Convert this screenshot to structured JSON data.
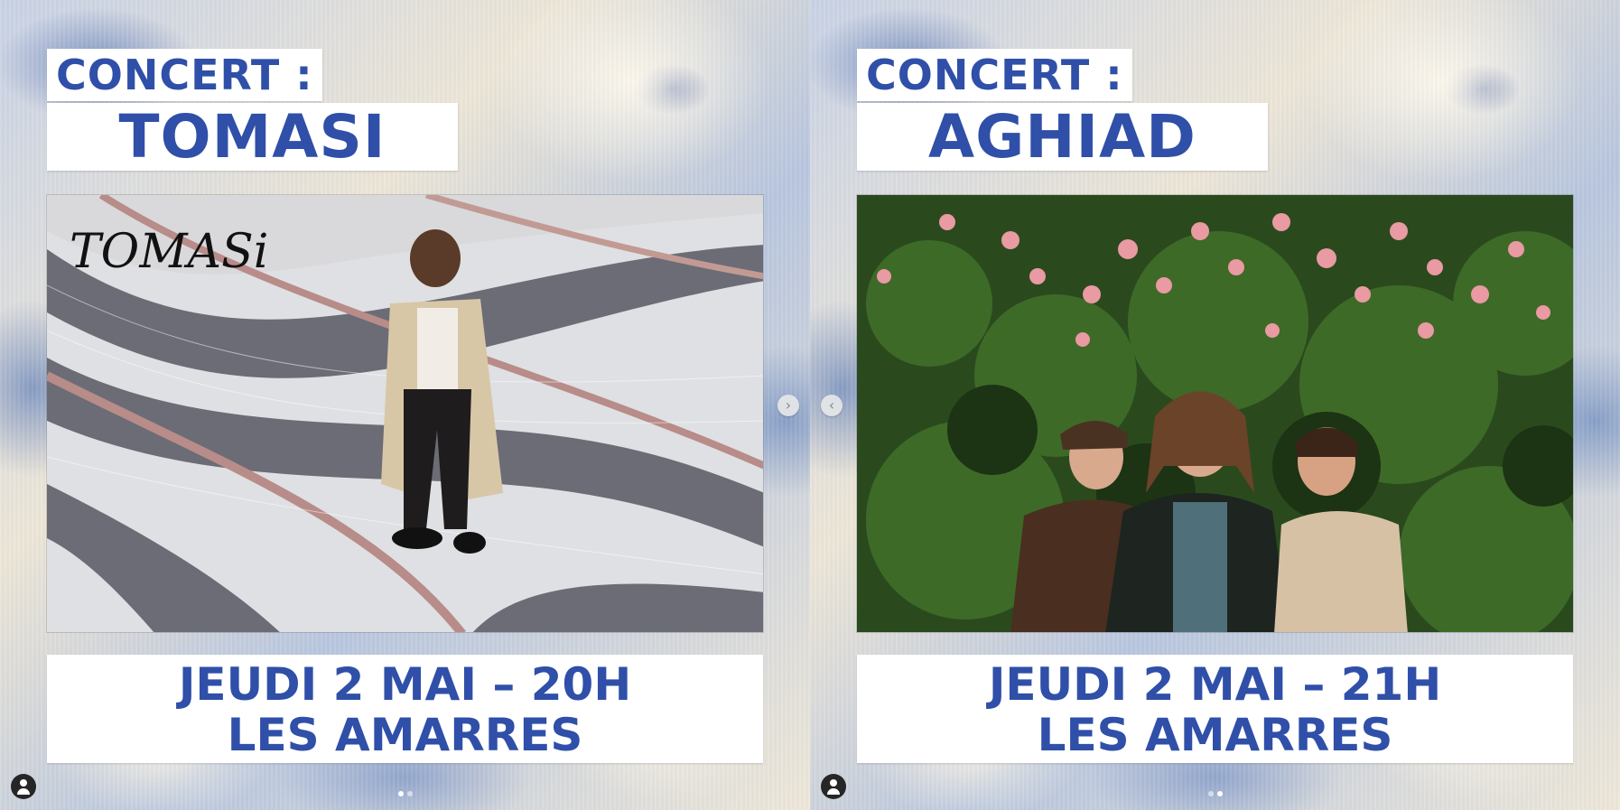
{
  "slides": [
    {
      "concert_label": "CONCERT :",
      "artist": "TOMASI",
      "photo_signature": "TOMASi",
      "date_line": "JEUDI 2 MAI – 20H",
      "venue_line": "LES AMARRES",
      "nav_icon": "chevron-right-icon",
      "nav_glyph": "›"
    },
    {
      "concert_label": "CONCERT :",
      "artist": "AGHIAD",
      "date_line": "JEUDI 2 MAI – 21H",
      "venue_line": "LES AMARRES",
      "nav_icon": "chevron-left-icon",
      "nav_glyph": "‹"
    }
  ],
  "colors": {
    "accent_blue": "#2f4fa8",
    "box_white": "#ffffff"
  },
  "carousel": {
    "slide_count": 2,
    "active_index_left": 1,
    "active_index_right": 2
  }
}
